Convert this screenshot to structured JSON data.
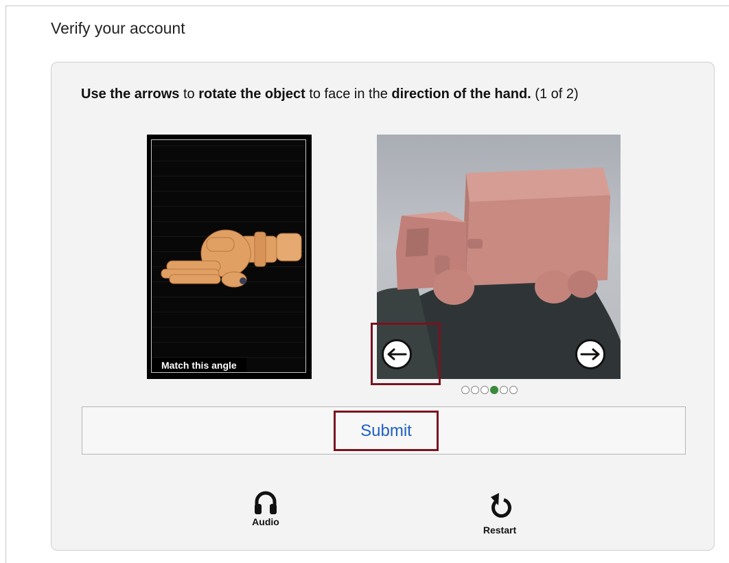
{
  "page": {
    "title": "Verify your account"
  },
  "challenge": {
    "instruction": [
      {
        "text": "Use the arrows",
        "bold": true
      },
      {
        "text": " to ",
        "bold": false
      },
      {
        "text": "rotate the object",
        "bold": true
      },
      {
        "text": " to face in the ",
        "bold": false
      },
      {
        "text": "direction of the hand.",
        "bold": true
      },
      {
        "text": " (1 of 2)",
        "bold": false
      }
    ],
    "reference_label": "Match this angle",
    "pagination": {
      "total": 6,
      "current": 4
    }
  },
  "actions": {
    "submit_label": "Submit"
  },
  "tools": {
    "audio_label": "Audio",
    "restart_label": "Restart"
  },
  "icons": {
    "left_arrow": "left-arrow-icon",
    "right_arrow": "right-arrow-icon",
    "audio": "headphones-icon",
    "restart": "restart-icon"
  },
  "colors": {
    "highlight": "#7a1220",
    "submit_text": "#1e5fc4",
    "active_dot": "#3a8a3a",
    "hand": "#e0a064",
    "truck": "#c98a82"
  }
}
